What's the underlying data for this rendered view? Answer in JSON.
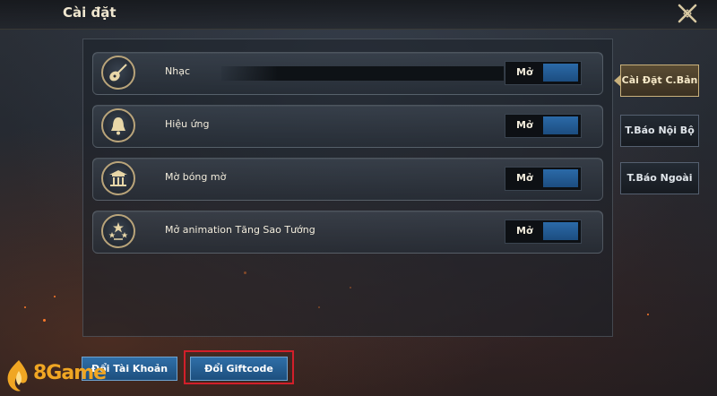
{
  "header": {
    "title": "Cài đặt"
  },
  "settings": [
    {
      "label": "Nhạc",
      "toggle": "Mở",
      "icon": "lute-icon",
      "has_slider": true
    },
    {
      "label": "Hiệu ứng",
      "toggle": "Mở",
      "icon": "bell-icon",
      "has_slider": false
    },
    {
      "label": "Mờ bóng mờ",
      "toggle": "Mở",
      "icon": "pavilion-icon",
      "has_slider": false
    },
    {
      "label": "Mở animation Tăng Sao Tướng",
      "toggle": "Mở",
      "icon": "stars-emblem-icon",
      "has_slider": false
    }
  ],
  "side_tabs": [
    {
      "label": "Cài Đặt C.Bản",
      "active": true
    },
    {
      "label": "T.Báo Nội Bộ",
      "active": false
    },
    {
      "label": "T.Báo Ngoài",
      "active": false
    }
  ],
  "buttons": {
    "change_account": "Đổi Tài Khoản",
    "redeem_giftcode": "Đổi Giftcode"
  },
  "brand": {
    "logo_text": "8Game"
  },
  "colors": {
    "accent_gold": "#c9b17c",
    "toggle_blue": "#2b6aa8",
    "highlight_red": "#d21f2a",
    "brand_orange": "#f0a623"
  }
}
